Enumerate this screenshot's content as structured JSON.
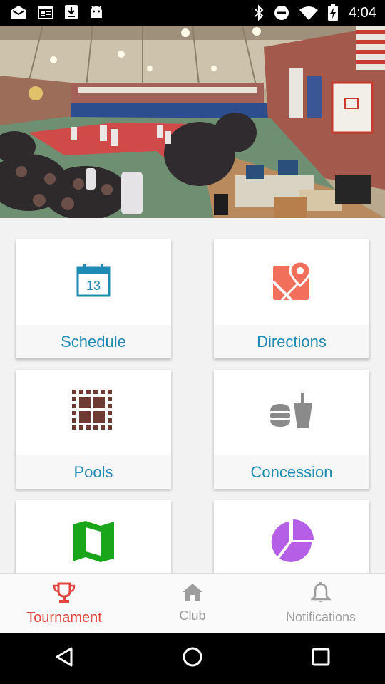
{
  "status_bar": {
    "time": "4:04",
    "left_icons": [
      "mail-icon",
      "calendar-icon",
      "download-icon",
      "android-icon"
    ],
    "right_icons": [
      "bluetooth-icon",
      "do-not-disturb-icon",
      "wifi-icon",
      "battery-charging-icon"
    ]
  },
  "hero": {
    "image": "gymnasium-judo-tournament-photo"
  },
  "cards": [
    {
      "label": "Schedule",
      "icon": "calendar-13-icon",
      "icon_text": "13",
      "color": "#1f8ab3"
    },
    {
      "label": "Directions",
      "icon": "map-pin-icon",
      "color": "#f26f5b"
    },
    {
      "label": "Pools",
      "icon": "grid-pools-icon",
      "color": "#6d3b32"
    },
    {
      "label": "Concession",
      "icon": "burger-drink-icon",
      "color": "#8a8a8a"
    },
    {
      "label": "",
      "icon": "map-icon",
      "color": "#1aa61a"
    },
    {
      "label": "",
      "icon": "pie-chart-icon",
      "color": "#b45fe6"
    }
  ],
  "bottom_nav": {
    "items": [
      {
        "label": "Tournament",
        "icon": "trophy-icon",
        "active": true
      },
      {
        "label": "Club",
        "icon": "home-icon",
        "active": false
      },
      {
        "label": "Notifications",
        "icon": "bell-icon",
        "active": false
      }
    ],
    "active_color": "#e0453f",
    "inactive_color": "#9e9e9e"
  },
  "system_nav": [
    "back-icon",
    "home-circle-icon",
    "recents-icon"
  ]
}
